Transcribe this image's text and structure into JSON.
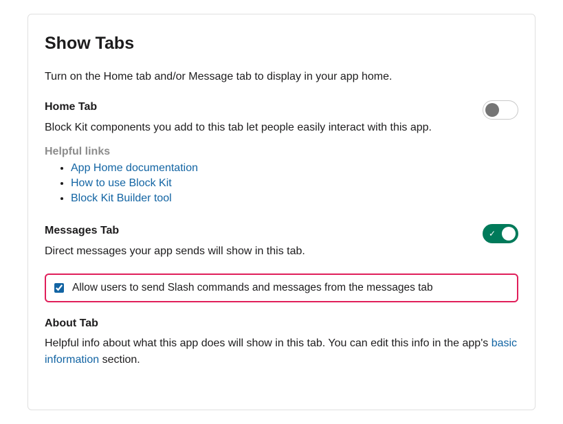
{
  "card": {
    "title": "Show Tabs",
    "intro": "Turn on the Home tab and/or Message tab to display in your app home."
  },
  "home_tab": {
    "title": "Home Tab",
    "desc": "Block Kit components you add to this tab let people easily interact with this app.",
    "helpful_label": "Helpful links",
    "links": [
      "App Home documentation",
      "How to use Block Kit",
      "Block Kit Builder tool"
    ],
    "enabled": false
  },
  "messages_tab": {
    "title": "Messages Tab",
    "desc": "Direct messages your app sends will show in this tab.",
    "enabled": true,
    "allow_slash_label": "Allow users to send Slash commands and messages from the messages tab",
    "allow_slash_checked": true
  },
  "about_tab": {
    "title": "About Tab",
    "desc_before": "Helpful info about what this app does will show in this tab. You can edit this info in the app's ",
    "link_text": "basic information",
    "desc_after": " section."
  }
}
